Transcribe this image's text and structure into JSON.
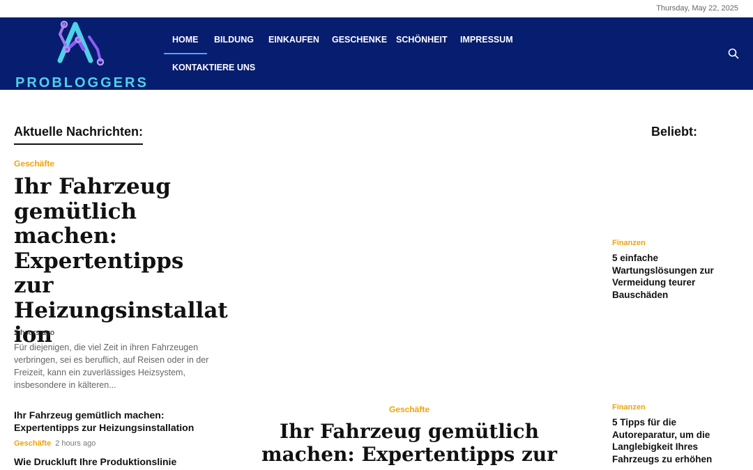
{
  "topbar": {
    "date": "Thursday, May 22, 2025"
  },
  "header": {
    "logo_text": "PROBLOGGERS",
    "brand_colors": {
      "background": "#071d6f",
      "logo_cyan": "#4fd1e8",
      "logo_purple": "#8b5cf6"
    },
    "nav": [
      {
        "label": "HOME",
        "active": true
      },
      {
        "label": "BILDUNG"
      },
      {
        "label": "EINKAUFEN"
      },
      {
        "label": "GESCHENKE"
      },
      {
        "label": "SCHÖNHEIT"
      },
      {
        "label": "IMPRESSUM"
      },
      {
        "label": "KONTAKTIERE UNS"
      }
    ],
    "search_icon": "search-icon"
  },
  "latest": {
    "heading": "Aktuelle Nachrichten:",
    "featured": {
      "category": "Geschäfte",
      "title": "Ihr Fahrzeug gemütlich machen: Expertentipps zur Heizungsinstallat ion",
      "time": "2 hours ago",
      "excerpt": "Für diejenigen, die viel Zeit in ihren Fahrzeugen verbringen, sei es beruflich, auf Reisen oder in der Freizeit, kann ein zuverlässiges Heizsystem, insbesondere in kälteren..."
    },
    "items": [
      {
        "title": "Ihr Fahrzeug gemütlich machen: Expertentipps zur Heizungsinstallation",
        "category": "Geschäfte",
        "time": "2 hours ago"
      },
      {
        "title": "Wie Druckluft Ihre Produktionslinie"
      }
    ]
  },
  "center": {
    "category": "Geschäfte",
    "title": "Ihr Fahrzeug gemütlich machen: Expertentipps zur"
  },
  "popular": {
    "heading": "Beliebt:",
    "items": [
      {
        "category": "Finanzen",
        "title": "5 einfache Wartungslösungen zur Vermeidung teurer Bauschäden"
      },
      {
        "category": "Finanzen",
        "title": "5 Tipps für die Autoreparatur, um die Langlebigkeit Ihres Fahrzeugs zu erhöhen"
      }
    ]
  },
  "accent_colors": {
    "category": "#f0a30a",
    "nav_active": "#4fa6ff"
  }
}
